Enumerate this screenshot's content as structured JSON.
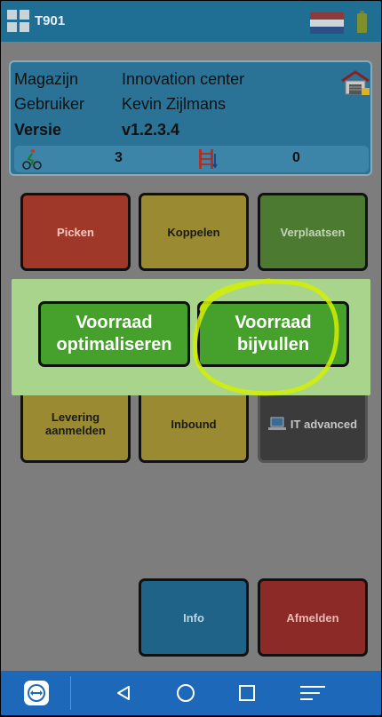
{
  "app": {
    "title": "T901"
  },
  "info": {
    "rows": [
      {
        "label": "Magazijn",
        "value": "Innovation center"
      },
      {
        "label": "Gebruiker",
        "value": "Kevin Zijlmans"
      },
      {
        "label": "Versie",
        "value": "v1.2.3.4"
      }
    ],
    "counters": {
      "picker_count": "3",
      "shelf_count": "0"
    }
  },
  "tiles": {
    "picken": "Picken",
    "koppelen": "Koppelen",
    "verplaatsen": "Verplaatsen",
    "levering": "Levering aanmelden",
    "inbound": "Inbound",
    "it_advanced": "IT advanced",
    "info": "Info",
    "afmelden": "Afmelden"
  },
  "dialog": {
    "btn_optimaliseren": "Voorraad optimaliseren",
    "btn_bijvullen": "Voorraad bijvullen"
  },
  "icons": {
    "app": "grid-icon",
    "flag": "netherlands-flag-icon",
    "battery": "battery-icon",
    "warehouse": "warehouse-icon",
    "picker": "cyclist-icon",
    "shelf": "shelf-icon",
    "it": "laptop-icon",
    "nav_remote": "teamviewer-icon",
    "nav_back": "back-icon",
    "nav_home": "home-icon",
    "nav_recents": "recents-icon",
    "nav_menu": "menu-icon"
  },
  "colors": {
    "topbar": "#1f6f95",
    "dialog_bg": "#a9d48b",
    "dialog_btn": "#45a12b",
    "highlight": "#d4f000",
    "navbar": "#1d68b8"
  }
}
